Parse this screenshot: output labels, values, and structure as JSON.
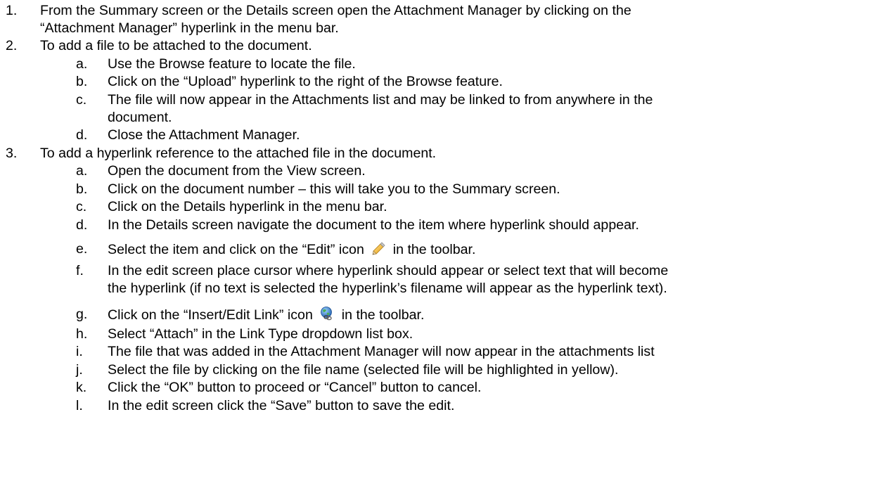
{
  "steps": [
    {
      "number": "1.",
      "lines": [
        "From the Summary screen or the Details screen open the Attachment Manager by clicking on the",
        "“Attachment Manager” hyperlink in the menu bar."
      ]
    },
    {
      "number": "2.",
      "lines": [
        "To add a file to be attached to the document."
      ],
      "substeps": [
        {
          "letter": "a.",
          "lines": [
            "Use the Browse feature to locate the file."
          ]
        },
        {
          "letter": "b.",
          "lines": [
            "Click on the “Upload” hyperlink to the right of the Browse feature."
          ]
        },
        {
          "letter": "c.",
          "lines": [
            "The file will now appear in the Attachments list and may be linked to from anywhere in the",
            "document."
          ]
        },
        {
          "letter": "d.",
          "lines": [
            "Close the Attachment Manager."
          ]
        }
      ]
    },
    {
      "number": "3.",
      "lines": [
        "To add a hyperlink reference to the attached file in the document."
      ],
      "substeps": [
        {
          "letter": "a.",
          "lines": [
            "Open the document from the View screen."
          ]
        },
        {
          "letter": "b.",
          "lines": [
            "Click on the document number – this will take you to the Summary screen."
          ]
        },
        {
          "letter": "c.",
          "lines": [
            "Click on the Details hyperlink in the menu bar."
          ]
        },
        {
          "letter": "d.",
          "lines": [
            "In the Details screen navigate the document to the item where hyperlink should appear."
          ]
        },
        {
          "letter": "e.",
          "pre": "Select the item and click on the “Edit” icon",
          "icon": "pencil-icon",
          "post": "in the toolbar."
        },
        {
          "letter": "f.",
          "lines": [
            "In the edit screen place cursor where hyperlink should appear or select text that will become",
            "the hyperlink (if no text is selected the hyperlink’s filename will appear as the hyperlink text)."
          ]
        },
        {
          "letter": "g.",
          "pre": "Click on the “Insert/Edit Link” icon",
          "icon": "globe-link-icon",
          "post": "in the toolbar."
        },
        {
          "letter": "h.",
          "lines": [
            "Select “Attach” in the Link Type dropdown list box."
          ]
        },
        {
          "letter": "i.",
          "lines": [
            "The file that was added in the Attachment Manager will now appear in the attachments list"
          ]
        },
        {
          "letter": "j.",
          "lines": [
            "Select the file by clicking on the file name (selected file will be highlighted in yellow)."
          ]
        },
        {
          "letter": "k.",
          "lines": [
            "Click the “OK” button to proceed or “Cancel” button to cancel."
          ]
        },
        {
          "letter": "l.",
          "lines": [
            "In the edit screen click the “Save” button to save the edit."
          ]
        }
      ]
    }
  ]
}
